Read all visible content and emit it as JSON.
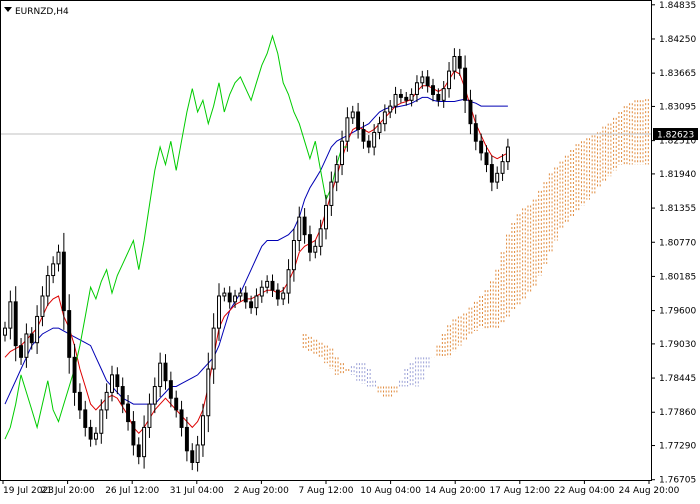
{
  "header": {
    "symbol_label": "EURNZD,H4"
  },
  "colors": {
    "candle": "#000000",
    "tenkan": "#dd0000",
    "kijun": "#0000b4",
    "chikou": "#00cc00",
    "kumo_bull": "#e08a3c",
    "kumo_bear": "#9aa0d6",
    "price_line": "#c0c0c0",
    "price_box_bg": "#000000",
    "price_box_fg": "#ffffff"
  },
  "chart_data": {
    "type": "candlestick",
    "title": "EURNZD,H4",
    "ylim": [
      1.767,
      1.849
    ],
    "y_ticks": [
      "1.84835",
      "1.84250",
      "1.83665",
      "1.83095",
      "1.82510",
      "1.81940",
      "1.81355",
      "1.80770",
      "1.80185",
      "1.79600",
      "1.79030",
      "1.78445",
      "1.77860",
      "1.77290",
      "1.76705"
    ],
    "x_ticks": [
      "19 Jul 2023",
      "21 Jul 20:00",
      "26 Jul 12:00",
      "31 Jul 04:00",
      "2 Aug 20:00",
      "7 Aug 12:00",
      "10 Aug 04:00",
      "14 Aug 20:00",
      "17 Aug 12:00",
      "22 Aug 04:00",
      "24 Aug 20:00"
    ],
    "current_price": "1.82623",
    "close": [
      1.793,
      1.7975,
      1.79,
      1.788,
      1.792,
      1.7905,
      1.795,
      1.7985,
      1.802,
      1.804,
      1.806,
      1.796,
      1.788,
      1.782,
      1.779,
      1.776,
      1.774,
      1.775,
      1.779,
      1.782,
      1.785,
      1.783,
      1.78,
      1.777,
      1.773,
      1.771,
      1.776,
      1.78,
      1.783,
      1.787,
      1.784,
      1.781,
      1.779,
      1.776,
      1.772,
      1.77,
      1.773,
      1.778,
      1.786,
      1.793,
      1.7985,
      1.799,
      1.7975,
      1.7985,
      1.799,
      1.7975,
      1.7965,
      1.7985,
      1.8,
      1.801,
      1.7995,
      1.798,
      1.799,
      1.803,
      1.808,
      1.812,
      1.809,
      1.806,
      1.807,
      1.81,
      1.814,
      1.818,
      1.821,
      1.825,
      1.829,
      1.83,
      1.827,
      1.825,
      1.824,
      1.8265,
      1.828,
      1.83,
      1.831,
      1.833,
      1.8325,
      1.832,
      1.833,
      1.835,
      1.836,
      1.8345,
      1.833,
      1.832,
      1.834,
      1.837,
      1.8395,
      1.8375,
      1.832,
      1.828,
      1.825,
      1.823,
      1.821,
      1.818,
      1.8195,
      1.8215,
      1.824
    ],
    "tenkan": [
      1.788,
      1.789,
      1.7895,
      1.79,
      1.791,
      1.792,
      1.793,
      1.795,
      1.797,
      1.798,
      1.7985,
      1.795,
      1.793,
      1.79,
      1.786,
      1.783,
      1.78,
      1.779,
      1.78,
      1.781,
      1.7815,
      1.781,
      1.7795,
      1.778,
      1.776,
      1.775,
      1.776,
      1.7775,
      1.779,
      1.78,
      1.781,
      1.78,
      1.779,
      1.778,
      1.777,
      1.776,
      1.777,
      1.779,
      1.783,
      1.788,
      1.793,
      1.795,
      1.796,
      1.797,
      1.7975,
      1.798,
      1.798,
      1.7985,
      1.799,
      1.7995,
      1.7995,
      1.799,
      1.7995,
      1.801,
      1.803,
      1.806,
      1.807,
      1.8075,
      1.808,
      1.81,
      1.813,
      1.816,
      1.819,
      1.822,
      1.825,
      1.827,
      1.8275,
      1.827,
      1.8265,
      1.827,
      1.828,
      1.829,
      1.83,
      1.831,
      1.8315,
      1.8318,
      1.8322,
      1.8335,
      1.8345,
      1.8345,
      1.834,
      1.8335,
      1.834,
      1.8355,
      1.837,
      1.8365,
      1.834,
      1.831,
      1.828,
      1.826,
      1.824,
      1.8225,
      1.822,
      1.8225,
      1.823
    ],
    "kijun": [
      1.78,
      1.782,
      1.784,
      1.786,
      1.788,
      1.79,
      1.791,
      1.792,
      1.7925,
      1.793,
      1.793,
      1.7925,
      1.792,
      1.7915,
      1.791,
      1.7905,
      1.79,
      1.788,
      1.786,
      1.784,
      1.783,
      1.782,
      1.781,
      1.7805,
      1.78,
      1.78,
      1.78,
      1.78,
      1.78,
      1.781,
      1.782,
      1.783,
      1.783,
      1.7835,
      1.784,
      1.7845,
      1.785,
      1.786,
      1.787,
      1.788,
      1.79,
      1.793,
      1.796,
      1.7975,
      1.799,
      1.801,
      1.803,
      1.805,
      1.807,
      1.808,
      1.808,
      1.808,
      1.8085,
      1.809,
      1.81,
      1.812,
      1.815,
      1.817,
      1.8185,
      1.82,
      1.822,
      1.824,
      1.825,
      1.8255,
      1.826,
      1.8265,
      1.827,
      1.8275,
      1.828,
      1.829,
      1.83,
      1.8305,
      1.8308,
      1.8308,
      1.831,
      1.8312,
      1.8315,
      1.832,
      1.8325,
      1.8325,
      1.832,
      1.8318,
      1.8318,
      1.8318,
      1.8318,
      1.832,
      1.8322,
      1.8318,
      1.8315,
      1.831,
      1.831,
      1.831,
      1.831,
      1.831,
      1.831
    ],
    "chikou": [
      1.774,
      1.776,
      1.78,
      1.785,
      1.782,
      1.779,
      1.776,
      1.78,
      1.784,
      1.779,
      1.777,
      1.78,
      1.783,
      1.786,
      1.79,
      1.795,
      1.8,
      1.798,
      1.801,
      1.803,
      1.799,
      1.802,
      1.804,
      1.806,
      1.808,
      1.803,
      1.808,
      1.814,
      1.82,
      1.824,
      1.821,
      1.825,
      1.82,
      1.825,
      1.83,
      1.834,
      1.83,
      1.832,
      1.828,
      1.831,
      1.835,
      1.83,
      1.833,
      1.835,
      1.836,
      1.834,
      1.832,
      1.835,
      1.838,
      1.84,
      1.843,
      1.84,
      1.835,
      1.833,
      1.83,
      1.828,
      1.825,
      1.822,
      1.825,
      1.82,
      1.815,
      1.817,
      1.821,
      1.824,
      1.824
    ],
    "span_a": [
      1.792,
      1.7915,
      1.791,
      1.7905,
      1.79,
      1.7895,
      1.788,
      1.787,
      1.786,
      1.785,
      1.784,
      1.7835,
      1.783,
      1.783,
      1.783,
      1.783,
      1.783,
      1.783,
      1.783,
      1.783,
      1.783,
      1.783,
      1.784,
      1.786,
      1.788,
      1.79,
      1.792,
      1.7935,
      1.7945,
      1.795,
      1.7955,
      1.7965,
      1.7975,
      1.7985,
      1.7995,
      1.801,
      1.803,
      1.806,
      1.809,
      1.811,
      1.8125,
      1.8135,
      1.814,
      1.815,
      1.8165,
      1.818,
      1.8195,
      1.8205,
      1.8215,
      1.8225,
      1.8235,
      1.8245,
      1.825,
      1.8255,
      1.826,
      1.8265,
      1.8275,
      1.828,
      1.829,
      1.83,
      1.831,
      1.8315,
      1.832,
      1.832,
      1.8322
    ],
    "span_b": [
      1.7895,
      1.789,
      1.7885,
      1.788,
      1.787,
      1.786,
      1.785,
      1.785,
      1.7855,
      1.7865,
      1.787,
      1.787,
      1.786,
      1.784,
      1.782,
      1.781,
      1.781,
      1.782,
      1.784,
      1.786,
      1.787,
      1.788,
      1.788,
      1.788,
      1.788,
      1.788,
      1.788,
      1.788,
      1.789,
      1.79,
      1.791,
      1.792,
      1.7925,
      1.793,
      1.793,
      1.793,
      1.793,
      1.794,
      1.795,
      1.796,
      1.797,
      1.798,
      1.799,
      1.8,
      1.802,
      1.804,
      1.806,
      1.808,
      1.81,
      1.811,
      1.812,
      1.813,
      1.814,
      1.815,
      1.816,
      1.817,
      1.818,
      1.819,
      1.82,
      1.821,
      1.821,
      1.821,
      1.821,
      1.821,
      1.821
    ]
  }
}
